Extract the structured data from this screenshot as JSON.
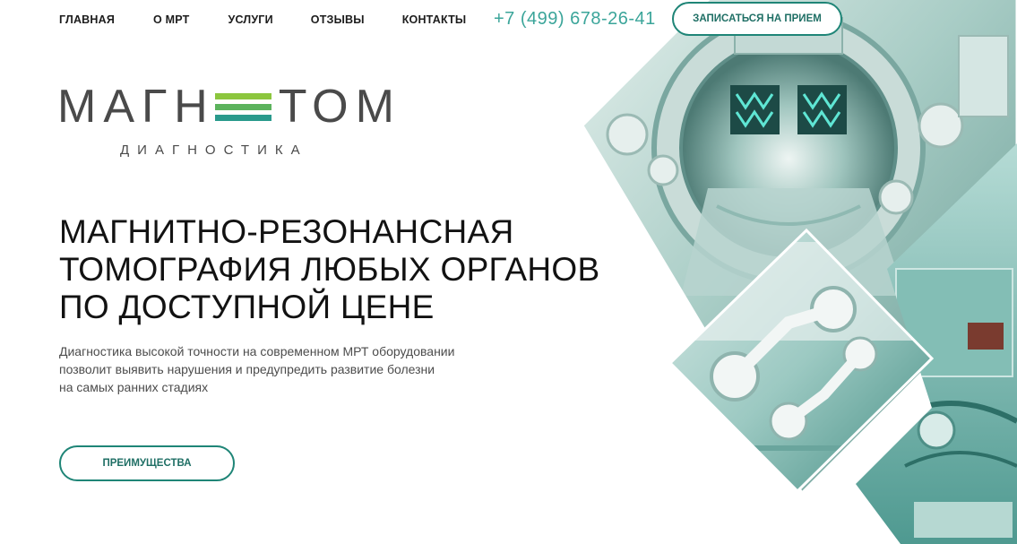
{
  "nav": {
    "items": [
      "ГЛАВНАЯ",
      "О МРТ",
      "УСЛУГИ",
      "ОТЗЫВЫ",
      "КОНТАКТЫ"
    ]
  },
  "header": {
    "phone": "+7 (499) 678-26-41",
    "cta_label": "ЗАПИСАТЬСЯ НА ПРИЕМ"
  },
  "logo": {
    "word_left": "МАГН",
    "word_right": "ТОМ",
    "subtitle": "ДИАГНОСТИКА"
  },
  "hero": {
    "headline_lines": [
      "МАГНИТНО-РЕЗОНАНСНАЯ",
      "ТОМОГРАФИЯ ЛЮБЫХ ОРГАНОВ",
      "ПО ДОСТУПНОЙ ЦЕНЕ"
    ],
    "description_lines": [
      "Диагностика высокой точности на современном МРТ оборудовании",
      "позволит выявить нарушения и предупредить развитие болезни",
      "на самых ранних стадиях"
    ],
    "button_label": "ПРЕИМУЩЕСТВА"
  },
  "colors": {
    "accent": "#3ba59a",
    "button_border": "#1f8577",
    "logo_bar_1": "#8cc63e",
    "logo_bar_2": "#5cb35d",
    "logo_bar_3": "#2a9a8c"
  },
  "images": {
    "collage": "mri-machine-robotics-diamond-collage"
  }
}
